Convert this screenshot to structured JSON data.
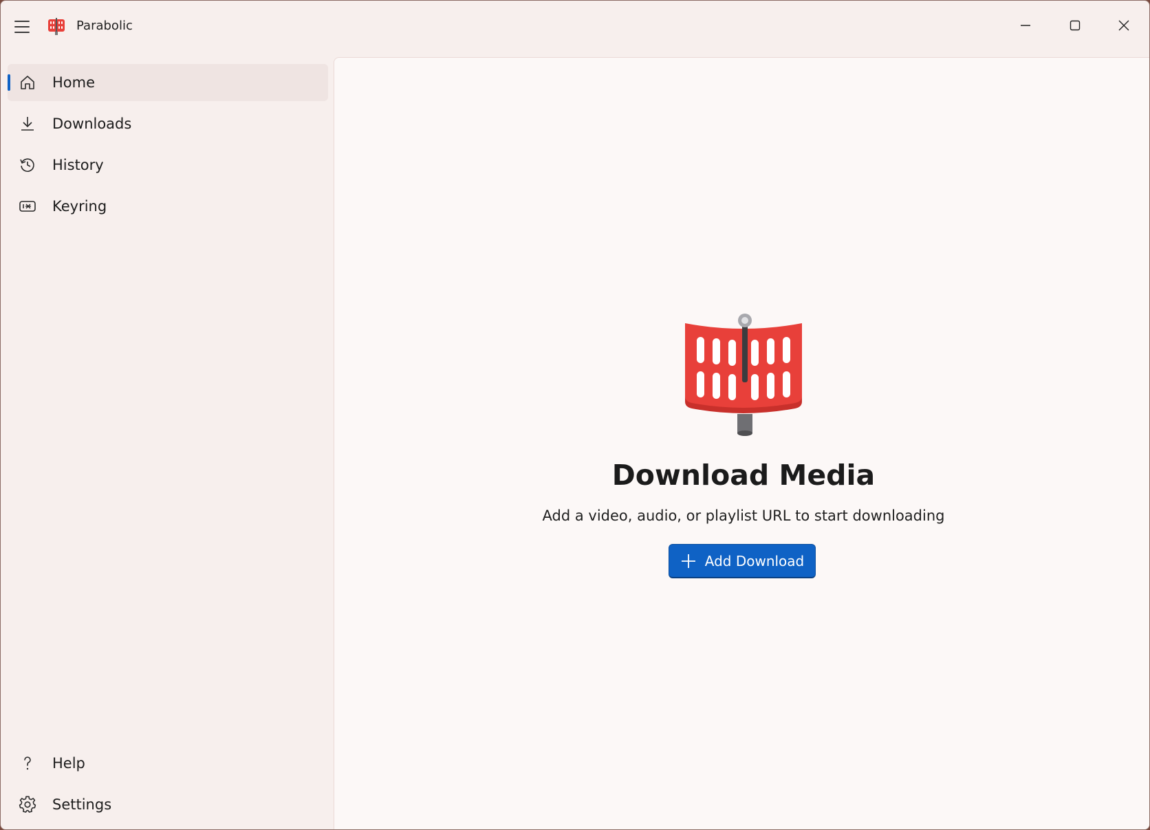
{
  "app": {
    "title": "Parabolic"
  },
  "sidebar": {
    "items": [
      {
        "label": "Home",
        "icon": "home-icon",
        "active": true
      },
      {
        "label": "Downloads",
        "icon": "download-icon",
        "active": false
      },
      {
        "label": "History",
        "icon": "history-icon",
        "active": false
      },
      {
        "label": "Keyring",
        "icon": "keyring-icon",
        "active": false
      }
    ],
    "footer_items": [
      {
        "label": "Help",
        "icon": "help-icon"
      },
      {
        "label": "Settings",
        "icon": "gear-icon"
      }
    ]
  },
  "main": {
    "title": "Download Media",
    "subtitle": "Add a video, audio, or playlist URL to start downloading",
    "add_button_label": "Add Download"
  },
  "colors": {
    "accent": "#0f62c5",
    "logo_red": "#e8403a",
    "window_bg": "#f7efed",
    "content_bg": "#fcf8f7"
  }
}
